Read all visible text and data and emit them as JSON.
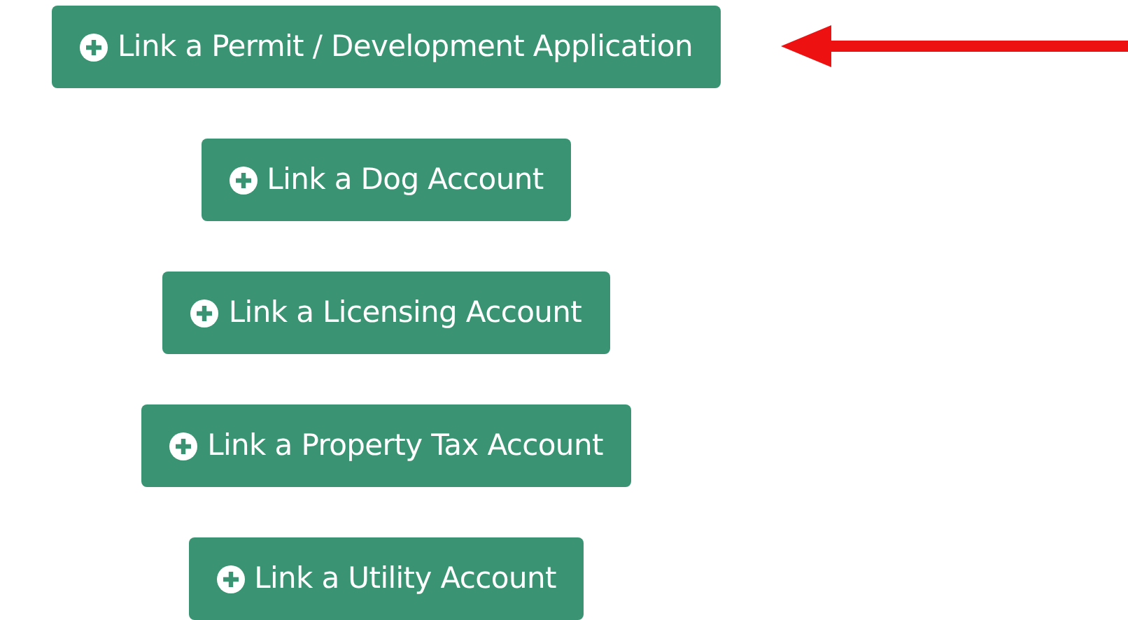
{
  "buttons": [
    {
      "label": "Link a Permit / Development Application"
    },
    {
      "label": "Link a Dog Account"
    },
    {
      "label": "Link a Licensing Account"
    },
    {
      "label": "Link a Property Tax Account"
    },
    {
      "label": "Link a Utility Account"
    }
  ]
}
